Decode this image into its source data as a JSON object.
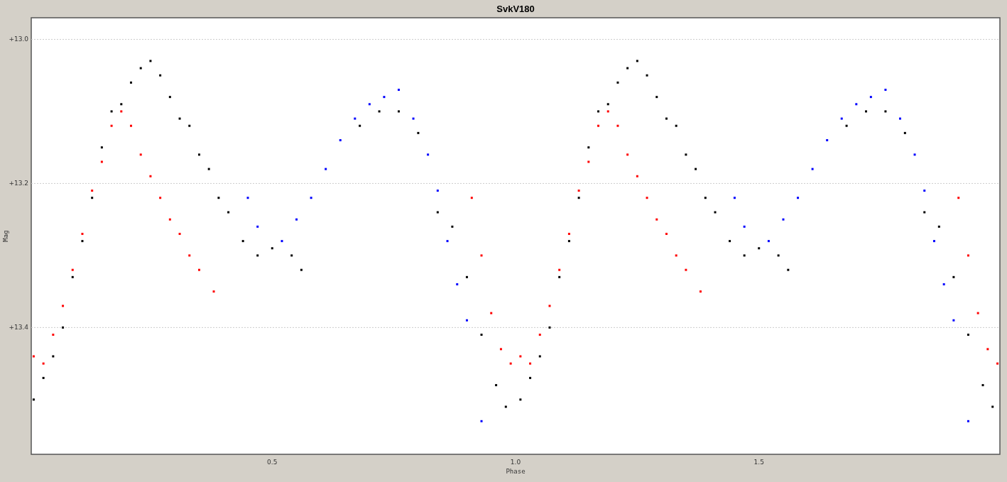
{
  "chart_data": {
    "type": "scatter",
    "title": "SvkV180",
    "xlabel": "Phase",
    "ylabel": "Mag",
    "grid": true,
    "xlim": [
      0.005,
      1.995
    ],
    "ylim": [
      13.576,
      12.97
    ],
    "xticks": [
      {
        "value": 0.5,
        "label": "0.5"
      },
      {
        "value": 1.0,
        "label": "1.0"
      },
      {
        "value": 1.5,
        "label": "1.5"
      }
    ],
    "yticks": [
      {
        "value": 13.0,
        "label": "+13.0"
      },
      {
        "value": 13.2,
        "label": "+13.2"
      },
      {
        "value": 13.4,
        "label": "+13.4"
      }
    ],
    "series": [
      {
        "color": "#000000",
        "x": [
          0.01,
          0.03,
          0.05,
          0.07,
          0.09,
          0.11,
          0.13,
          0.15,
          0.17,
          0.19,
          0.21,
          0.23,
          0.25,
          0.27,
          0.29,
          0.31,
          0.33,
          0.35,
          0.37,
          0.39,
          0.41,
          0.44,
          0.47,
          0.5,
          0.54,
          0.56,
          0.68,
          0.72,
          0.76,
          0.8,
          0.84,
          0.87,
          0.9,
          0.93,
          0.96,
          0.98,
          1.01,
          1.03,
          1.05,
          1.07,
          1.09,
          1.11,
          1.13,
          1.15,
          1.17,
          1.19,
          1.21,
          1.23,
          1.25,
          1.27,
          1.29,
          1.31,
          1.33,
          1.35,
          1.37,
          1.39,
          1.41,
          1.44,
          1.47,
          1.5,
          1.54,
          1.56,
          1.68,
          1.72,
          1.76,
          1.8,
          1.84,
          1.87,
          1.9,
          1.93,
          1.96,
          1.98
        ],
        "values": [
          13.5,
          13.47,
          13.44,
          13.4,
          13.33,
          13.28,
          13.22,
          13.15,
          13.1,
          13.09,
          13.06,
          13.04,
          13.03,
          13.05,
          13.08,
          13.11,
          13.12,
          13.16,
          13.18,
          13.22,
          13.24,
          13.28,
          13.3,
          13.29,
          13.3,
          13.32,
          13.12,
          13.1,
          13.1,
          13.13,
          13.24,
          13.26,
          13.33,
          13.41,
          13.48,
          13.51,
          13.5,
          13.47,
          13.44,
          13.4,
          13.33,
          13.28,
          13.22,
          13.15,
          13.1,
          13.09,
          13.06,
          13.04,
          13.03,
          13.05,
          13.08,
          13.11,
          13.12,
          13.16,
          13.18,
          13.22,
          13.24,
          13.28,
          13.3,
          13.29,
          13.3,
          13.32,
          13.12,
          13.1,
          13.1,
          13.13,
          13.24,
          13.26,
          13.33,
          13.41,
          13.48,
          13.51
        ]
      },
      {
        "color": "#ff0000",
        "x": [
          0.01,
          0.03,
          0.05,
          0.07,
          0.09,
          0.11,
          0.13,
          0.15,
          0.17,
          0.19,
          0.21,
          0.23,
          0.25,
          0.27,
          0.29,
          0.31,
          0.33,
          0.35,
          0.38,
          0.91,
          0.93,
          0.95,
          0.97,
          0.99,
          1.01,
          1.03,
          1.05,
          1.07,
          1.09,
          1.11,
          1.13,
          1.15,
          1.17,
          1.19,
          1.21,
          1.23,
          1.25,
          1.27,
          1.29,
          1.31,
          1.33,
          1.35,
          1.38,
          1.91,
          1.93,
          1.95,
          1.97,
          1.99
        ],
        "values": [
          13.44,
          13.45,
          13.41,
          13.37,
          13.32,
          13.27,
          13.21,
          13.17,
          13.12,
          13.1,
          13.12,
          13.16,
          13.19,
          13.22,
          13.25,
          13.27,
          13.3,
          13.32,
          13.35,
          13.22,
          13.3,
          13.38,
          13.43,
          13.45,
          13.44,
          13.45,
          13.41,
          13.37,
          13.32,
          13.27,
          13.21,
          13.17,
          13.12,
          13.1,
          13.12,
          13.16,
          13.19,
          13.22,
          13.25,
          13.27,
          13.3,
          13.32,
          13.35,
          13.22,
          13.3,
          13.38,
          13.43,
          13.45
        ]
      },
      {
        "color": "#0000ff",
        "x": [
          0.45,
          0.47,
          0.52,
          0.55,
          0.58,
          0.61,
          0.64,
          0.67,
          0.7,
          0.73,
          0.76,
          0.79,
          0.82,
          0.84,
          0.86,
          0.88,
          0.9,
          0.93,
          1.45,
          1.47,
          1.52,
          1.55,
          1.58,
          1.61,
          1.64,
          1.67,
          1.7,
          1.73,
          1.76,
          1.79,
          1.82,
          1.84,
          1.86,
          1.88,
          1.9,
          1.93
        ],
        "values": [
          13.22,
          13.26,
          13.28,
          13.25,
          13.22,
          13.18,
          13.14,
          13.11,
          13.09,
          13.08,
          13.07,
          13.11,
          13.16,
          13.21,
          13.28,
          13.34,
          13.39,
          13.53,
          13.22,
          13.26,
          13.28,
          13.25,
          13.22,
          13.18,
          13.14,
          13.11,
          13.09,
          13.08,
          13.07,
          13.11,
          13.16,
          13.21,
          13.28,
          13.34,
          13.39,
          13.53
        ]
      }
    ]
  }
}
